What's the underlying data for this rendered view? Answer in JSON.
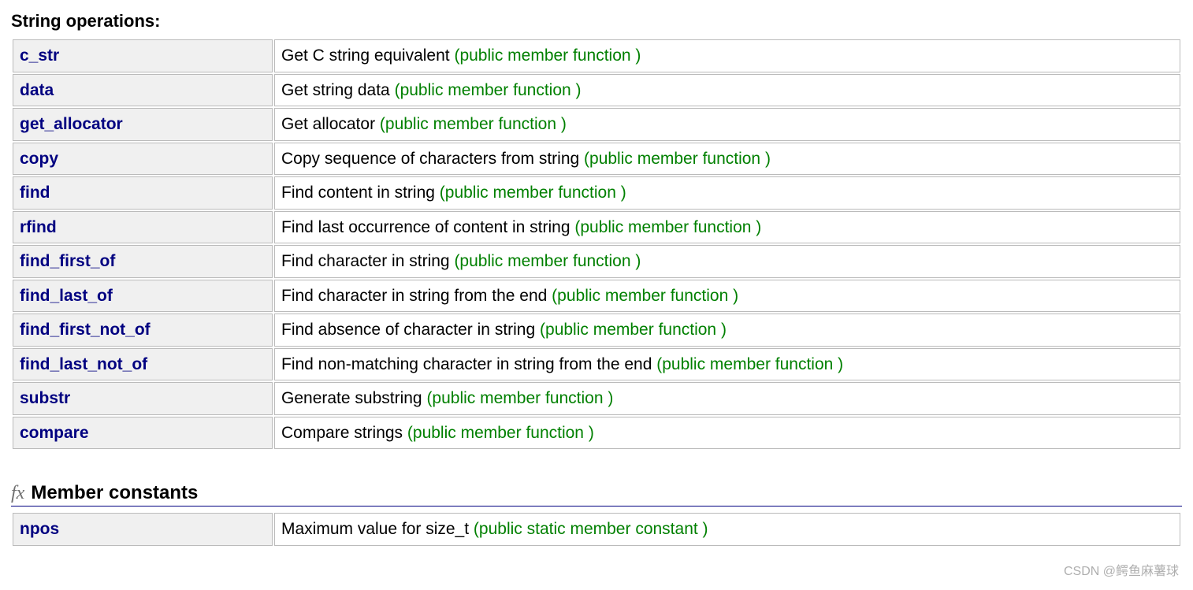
{
  "section1": {
    "title": "String operations",
    "rows": [
      {
        "name": "c_str",
        "desc": "Get C string equivalent ",
        "tag": "(public member function )"
      },
      {
        "name": "data",
        "desc": "Get string data ",
        "tag": "(public member function )"
      },
      {
        "name": "get_allocator",
        "desc": "Get allocator ",
        "tag": "(public member function )"
      },
      {
        "name": "copy",
        "desc": "Copy sequence of characters from string ",
        "tag": "(public member function )"
      },
      {
        "name": "find",
        "desc": "Find content in string ",
        "tag": "(public member function )"
      },
      {
        "name": "rfind",
        "desc": "Find last occurrence of content in string ",
        "tag": "(public member function )"
      },
      {
        "name": "find_first_of",
        "desc": "Find character in string ",
        "tag": "(public member function )"
      },
      {
        "name": "find_last_of",
        "desc": "Find character in string from the end ",
        "tag": "(public member function )"
      },
      {
        "name": "find_first_not_of",
        "desc": "Find absence of character in string ",
        "tag": "(public member function )"
      },
      {
        "name": "find_last_not_of",
        "desc": "Find non-matching character in string from the end ",
        "tag": "(public member function )"
      },
      {
        "name": "substr",
        "desc": "Generate substring ",
        "tag": "(public member function )"
      },
      {
        "name": "compare",
        "desc": "Compare strings ",
        "tag": "(public member function )"
      }
    ]
  },
  "section2": {
    "icon": "fx",
    "title": "Member constants",
    "rows": [
      {
        "name": "npos",
        "desc": "Maximum value for size_t ",
        "tag": "(public static member constant )"
      }
    ]
  },
  "watermark": "CSDN @鳄鱼麻薯球"
}
